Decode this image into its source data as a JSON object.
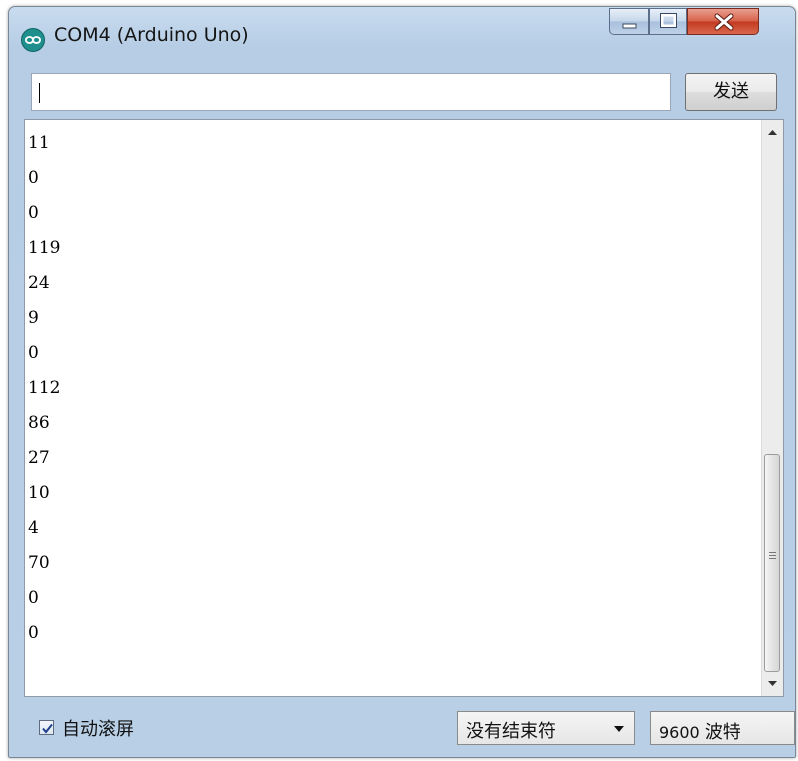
{
  "window": {
    "title": "COM4 (Arduino Uno)",
    "app_icon": "arduino-infinity-icon",
    "controls": {
      "minimize_icon": "minimize-icon",
      "maximize_icon": "maximize-icon",
      "close_icon": "close-icon"
    }
  },
  "send": {
    "input_value": "",
    "button_label": "发送"
  },
  "output": {
    "lines": [
      "11",
      "0",
      "0",
      "119",
      "24",
      "9",
      "0",
      "112",
      "86",
      "27",
      "10",
      "4",
      "70",
      "0",
      "0"
    ],
    "scroll_position": 0.9
  },
  "status": {
    "autoscroll_label": "自动滚屏",
    "autoscroll_checked": true,
    "line_ending": "没有结束符",
    "baud_value": "9600",
    "baud_unit": "波特"
  },
  "colors": {
    "title_gradient": "#c9dcef",
    "close_button": "#c23a20",
    "icon_teal": "#1f8f8d"
  }
}
